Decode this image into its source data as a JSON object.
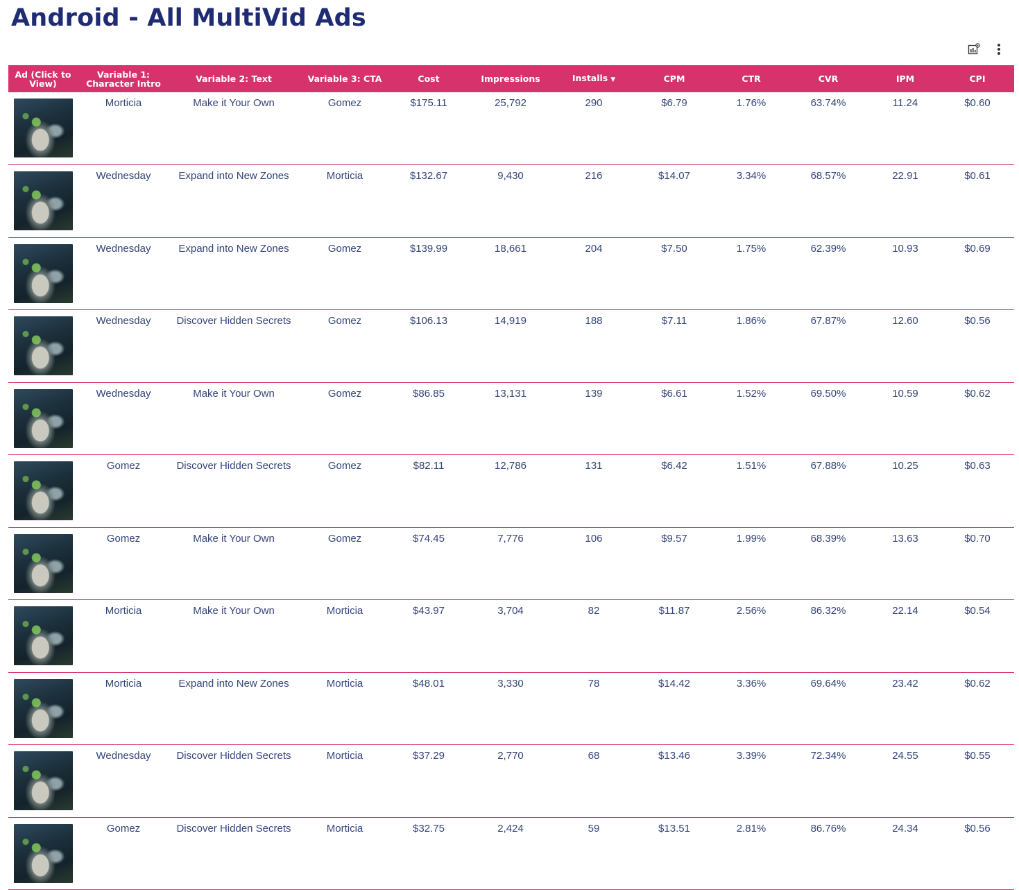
{
  "title": "Android - All MultiVid Ads",
  "toolbar": {
    "icons": [
      "chart-settings-icon",
      "more-vert-icon"
    ]
  },
  "colors": {
    "accent": "#d6336c",
    "title": "#1f2b72",
    "text": "#35457a"
  },
  "table": {
    "headers": [
      "Ad (Click to View)",
      "Variable 1: Character Intro",
      "Variable 2: Text",
      "Variable 3: CTA",
      "Cost",
      "Impressions",
      "Installs",
      "CPM",
      "CTR",
      "CVR",
      "IPM",
      "CPI"
    ],
    "sort_indicator": "▼",
    "rows": [
      [
        "Morticia",
        "Make it Your Own",
        "Gomez",
        "$175.11",
        "25,792",
        "290",
        "$6.79",
        "1.76%",
        "63.74%",
        "11.24",
        "$0.60"
      ],
      [
        "Wednesday",
        "Expand into New Zones",
        "Morticia",
        "$132.67",
        "9,430",
        "216",
        "$14.07",
        "3.34%",
        "68.57%",
        "22.91",
        "$0.61"
      ],
      [
        "Wednesday",
        "Expand into New Zones",
        "Gomez",
        "$139.99",
        "18,661",
        "204",
        "$7.50",
        "1.75%",
        "62.39%",
        "10.93",
        "$0.69"
      ],
      [
        "Wednesday",
        "Discover Hidden Secrets",
        "Gomez",
        "$106.13",
        "14,919",
        "188",
        "$7.11",
        "1.86%",
        "67.87%",
        "12.60",
        "$0.56"
      ],
      [
        "Wednesday",
        "Make it Your Own",
        "Gomez",
        "$86.85",
        "13,131",
        "139",
        "$6.61",
        "1.52%",
        "69.50%",
        "10.59",
        "$0.62"
      ],
      [
        "Gomez",
        "Discover Hidden Secrets",
        "Gomez",
        "$82.11",
        "12,786",
        "131",
        "$6.42",
        "1.51%",
        "67.88%",
        "10.25",
        "$0.63"
      ],
      [
        "Gomez",
        "Make it Your Own",
        "Gomez",
        "$74.45",
        "7,776",
        "106",
        "$9.57",
        "1.99%",
        "68.39%",
        "13.63",
        "$0.70"
      ],
      [
        "Morticia",
        "Make it Your Own",
        "Morticia",
        "$43.97",
        "3,704",
        "82",
        "$11.87",
        "2.56%",
        "86.32%",
        "22.14",
        "$0.54"
      ],
      [
        "Morticia",
        "Expand into New Zones",
        "Morticia",
        "$48.01",
        "3,330",
        "78",
        "$14.42",
        "3.36%",
        "69.64%",
        "23.42",
        "$0.62"
      ],
      [
        "Wednesday",
        "Discover Hidden Secrets",
        "Morticia",
        "$37.29",
        "2,770",
        "68",
        "$13.46",
        "3.39%",
        "72.34%",
        "24.55",
        "$0.55"
      ],
      [
        "Gomez",
        "Discover Hidden Secrets",
        "Morticia",
        "$32.75",
        "2,424",
        "59",
        "$13.51",
        "2.81%",
        "86.76%",
        "24.34",
        "$0.56"
      ]
    ]
  }
}
